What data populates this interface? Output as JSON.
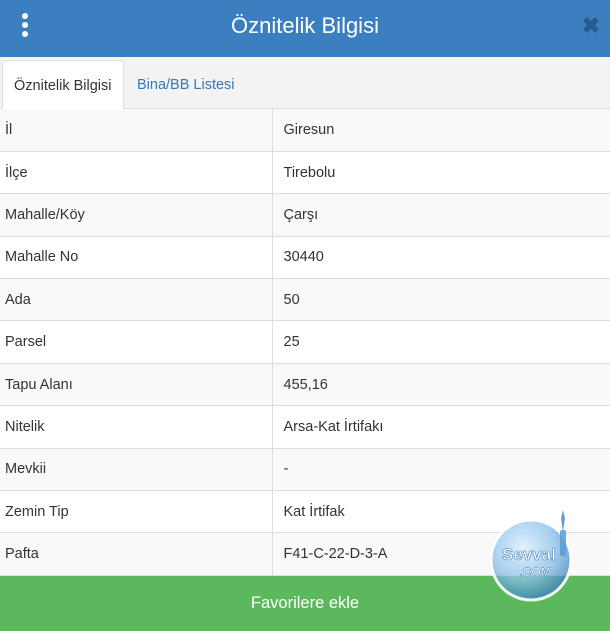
{
  "header": {
    "title": "Öznitelik Bilgisi",
    "close_symbol": "✖"
  },
  "tabs": [
    {
      "label": "Öznitelik Bilgisi",
      "active": true
    },
    {
      "label": "Bina/BB Listesi",
      "active": false
    }
  ],
  "rows": [
    {
      "label": "İl",
      "value": "Giresun"
    },
    {
      "label": "İlçe",
      "value": "Tirebolu"
    },
    {
      "label": "Mahalle/Köy",
      "value": "Çarşı"
    },
    {
      "label": "Mahalle No",
      "value": "30440"
    },
    {
      "label": "Ada",
      "value": "50"
    },
    {
      "label": "Parsel",
      "value": "25"
    },
    {
      "label": "Tapu Alanı",
      "value": "455,16"
    },
    {
      "label": "Nitelik",
      "value": "Arsa-Kat İrtifakı"
    },
    {
      "label": "Mevkii",
      "value": "-"
    },
    {
      "label": "Zemin Tip",
      "value": "Kat İrtifak"
    },
    {
      "label": "Pafta",
      "value": "F41-C-22-D-3-A"
    }
  ],
  "favorite_button": {
    "label": "Favorilere ekle"
  },
  "watermark": {
    "line1": "Sevval",
    "line2": ".COM"
  },
  "colors": {
    "header": "#3c7fc1",
    "tab_link": "#337ab7",
    "favorite_button": "#5cb85c",
    "close_icon": "#2a5b8d"
  }
}
